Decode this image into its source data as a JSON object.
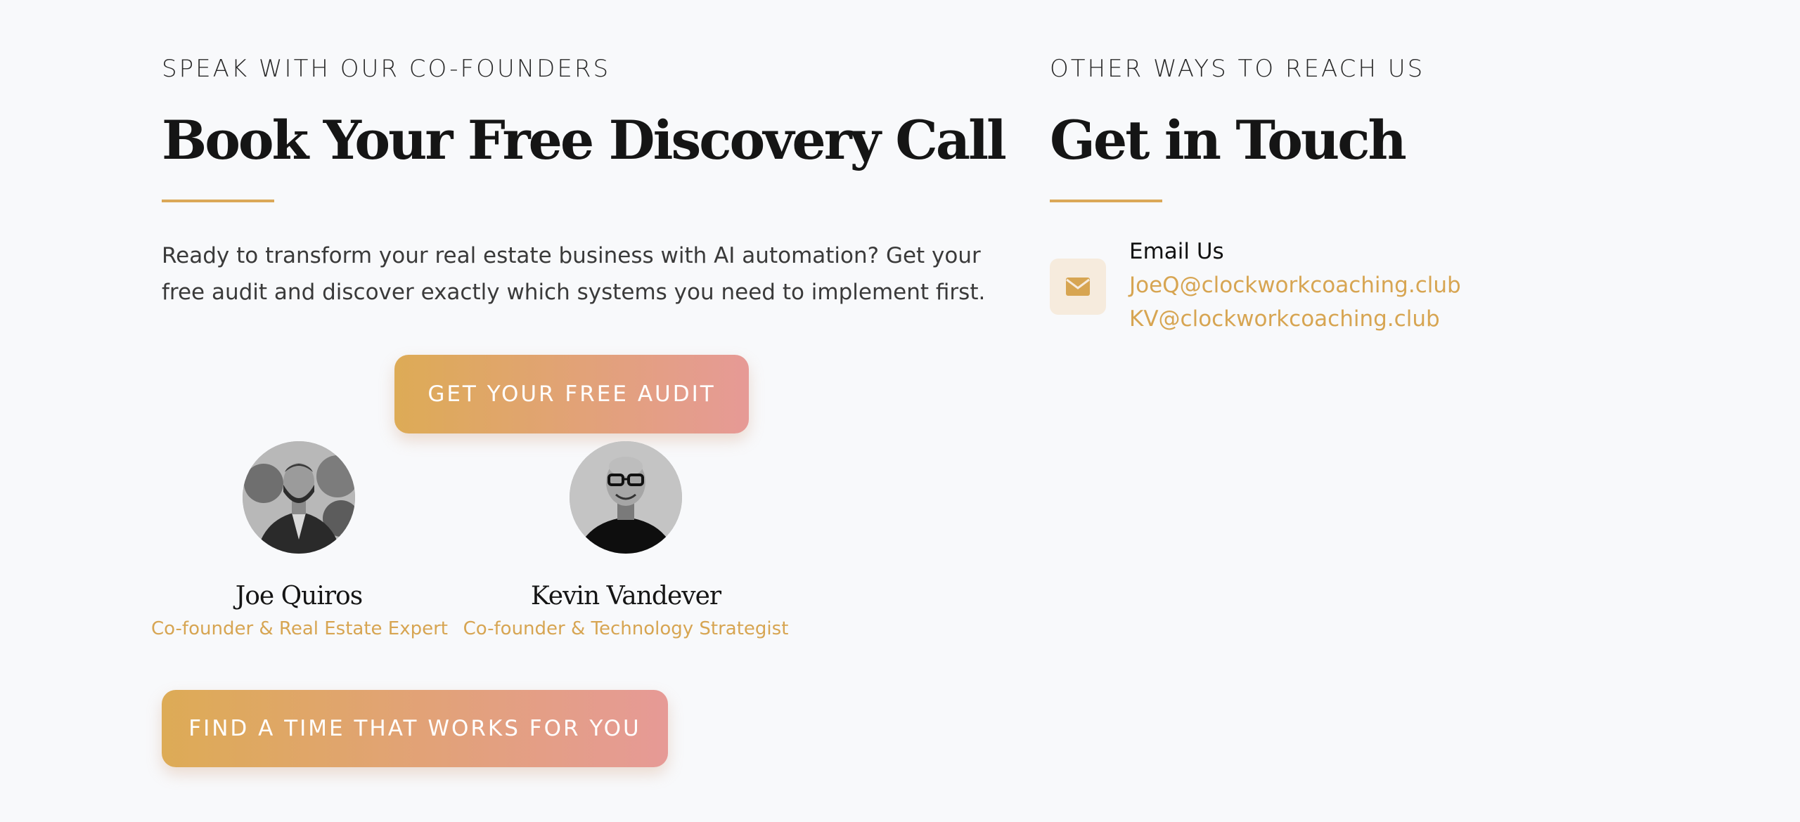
{
  "booking": {
    "eyebrow": "SPEAK WITH OUR CO-FOUNDERS",
    "title": "Book Your Free Discovery Call",
    "intro": "Ready to transform your real estate business with AI automation? Get your free audit and discover exactly which systems you need to implement first.",
    "audit_button": "GET YOUR FREE AUDIT",
    "schedule_button": "FIND A TIME THAT WORKS FOR YOU",
    "founders": [
      {
        "name": "Joe Quiros",
        "role": "Co-founder & Real Estate Expert"
      },
      {
        "name": "Kevin Vandever",
        "role": "Co-founder & Technology Strategist"
      }
    ]
  },
  "contact": {
    "eyebrow": "OTHER WAYS TO REACH US",
    "title": "Get in Touch",
    "email_label": "Email Us",
    "emails": [
      "JoeQ@clockworkcoaching.club",
      "KV@clockworkcoaching.club"
    ],
    "icon": "envelope-icon"
  },
  "colors": {
    "accent": "#dba858",
    "gradient_start": "#ddab56",
    "gradient_end": "#e69a96",
    "background": "#f8f9fb"
  }
}
